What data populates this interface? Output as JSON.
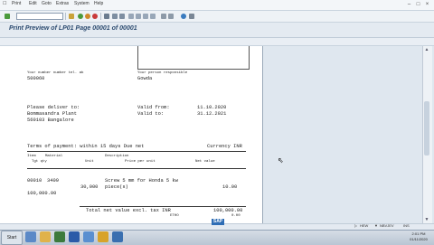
{
  "menubar": {
    "items": [
      "Print",
      "Edit",
      "Goto",
      "Extras",
      "System",
      "Help"
    ]
  },
  "window": {
    "title": "Print Preview of LP01 Page 00001 of 00001"
  },
  "document": {
    "sender_label_left": "Your number number tel. ab",
    "sender_value_left": "500060",
    "sender_label_right": "Your person responsible",
    "sender_value_right": "Gowda",
    "deliver_heading": "Please deliver to:",
    "deliver_line1": "Bommasandra Plant",
    "deliver_line2": "560103 Bangalore",
    "valid_from_label": "Valid from:",
    "valid_from_value": "11.10.2020",
    "valid_to_label": "Valid to:",
    "valid_to_value": "31.12.2021",
    "terms_text": "Terms of payment: within 15 days Due net",
    "currency_text": "Currency INR",
    "col_item": "Item",
    "col_material": "Material",
    "col_description": "Description",
    "col_tgt_qty": "Tgt qty",
    "col_unit": "Unit",
    "col_price_per_unit": "Price per unit",
    "col_net_value": "Net value",
    "row_item": "00010",
    "row_material": "3409",
    "row_description": "Screw 5 mm for Honda 5 kw",
    "row_qty": "30,000",
    "row_unit": "piece(s)",
    "row_price": "10.00",
    "row_net_value": "100,000.00",
    "total_label": "Total net value excl. tax INR",
    "total_value": "100,000.00",
    "total_sub": "ETHO",
    "total_sub_value": "0.00"
  },
  "statusbar": {
    "system": "HEW",
    "client": "NBVJEV",
    "mode": "INS"
  },
  "taskbar": {
    "start_label": "Start",
    "clock_time": "2:01 PM",
    "clock_date": "01/11/2020"
  },
  "colors": {
    "title": "#2b4a6f",
    "accent": "#2f6db5"
  }
}
